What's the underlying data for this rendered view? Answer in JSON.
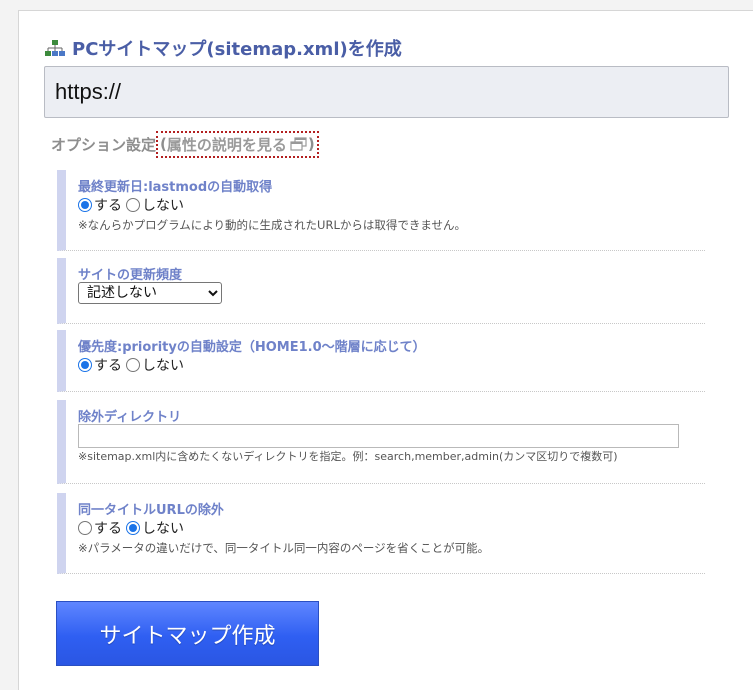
{
  "title": "PCサイトマップ(sitemap.xml)を作成",
  "url_input": {
    "value": "https://"
  },
  "options": {
    "label": "オプション設定",
    "paren_open": "(",
    "attr_link": "属性の説明を見る",
    "paren_close": ")"
  },
  "sections": {
    "lastmod": {
      "title": "最終更新日:lastmodの自動取得",
      "radio_yes": "する",
      "radio_no": "しない",
      "selected": "yes",
      "note": "※なんらかプログラムにより動的に生成されたURLからは取得できません。"
    },
    "freq": {
      "title": "サイトの更新頻度",
      "selected": "記述しない"
    },
    "priority": {
      "title": "優先度:priorityの自動設定（HOME1.0～階層に応じて）",
      "radio_yes": "する",
      "radio_no": "しない",
      "selected": "yes"
    },
    "exclude_dir": {
      "title": "除外ディレクトリ",
      "value": "",
      "note": "※sitemap.xml内に含めたくないディレクトリを指定。例：search,member,admin(カンマ区切りで複数可)"
    },
    "same_title": {
      "title": "同一タイトルURLの除外",
      "radio_yes": "する",
      "radio_no": "しない",
      "selected": "no",
      "note": "※パラメータの違いだけで、同一タイトル同一内容のページを省くことが可能。"
    }
  },
  "submit_label": "サイトマップ作成",
  "icons": {
    "title": "sitemap-icon",
    "attr_link": "external-window-icon"
  },
  "colors": {
    "title": "#4a5ea6",
    "section_title": "#6f82c9",
    "section_bar": "#cfd4ef",
    "button": "#3b66f5"
  }
}
